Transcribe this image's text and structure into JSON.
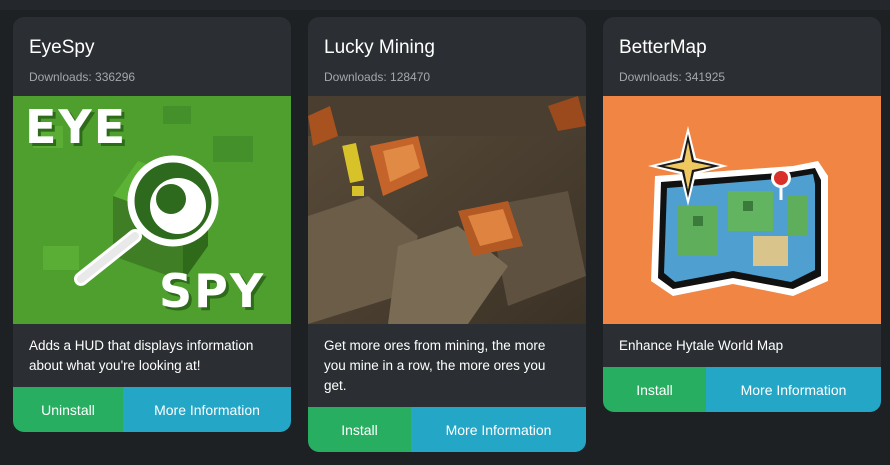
{
  "cards": [
    {
      "title": "EyeSpy",
      "downloads": "Downloads: 336296",
      "thumb_text_top": "EYE",
      "thumb_text_bottom": "SPY",
      "description": "Adds a HUD that displays information about what you're looking at!",
      "primary_button": "Uninstall",
      "info_button": "More Information"
    },
    {
      "title": "Lucky Mining",
      "downloads": "Downloads: 128470",
      "description": "Get more ores from mining, the more you mine in a row, the more ores you get.",
      "primary_button": "Install",
      "info_button": "More Information"
    },
    {
      "title": "BetterMap",
      "downloads": "Downloads: 341925",
      "description": "Enhance Hytale World Map",
      "primary_button": "Install",
      "info_button": "More Information"
    }
  ],
  "colors": {
    "background": "#1e2124",
    "card": "#2b2f33",
    "install_green": "#27ae60",
    "info_blue": "#24a6c7"
  }
}
